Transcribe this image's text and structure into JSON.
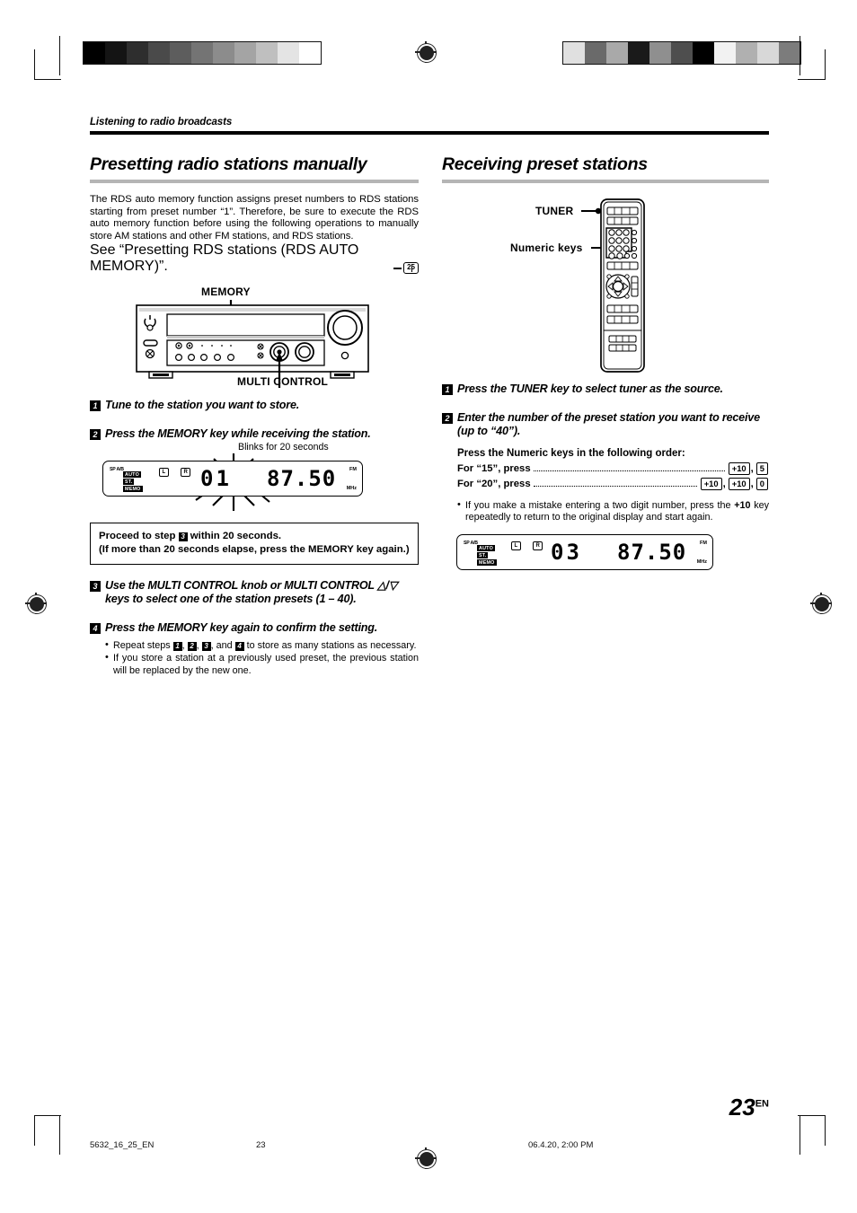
{
  "page": {
    "running_head": "Listening to radio broadcasts",
    "folio_number": "23",
    "folio_suffix": "EN"
  },
  "footer": {
    "filename": "5632_16_25_EN",
    "page": "23",
    "timestamp": "06.4.20, 2:00 PM"
  },
  "left_column": {
    "title": "Presetting radio stations manually",
    "intro": "The RDS auto memory function assigns preset numbers to RDS stations starting from preset number “1”. Therefore, be sure to execute the RDS auto memory function before using the following operations to manually store AM stations and other FM stations, and RDS stations.",
    "see_line": "See “Presetting RDS stations (RDS AUTO MEMORY)”.",
    "page_reference": "25",
    "device_callout_top": "MEMORY",
    "device_callout_bottom": "MULTI CONTROL",
    "steps": [
      {
        "num": "1",
        "text": "Tune to the station you want to store."
      },
      {
        "num": "2",
        "text": "Press the MEMORY key while receiving the station."
      },
      {
        "num": "3",
        "text": "Use the MULTI CONTROL knob or MULTI CONTROL △/▽ keys to select one of the station presets (1 – 40)."
      },
      {
        "num": "4",
        "text": "Press the MEMORY key  again to confirm the setting."
      }
    ],
    "blink_label": "Blinks for 20 seconds",
    "note_box": {
      "line1_before": "Proceed to step ",
      "line1_step": "3",
      "line1_after": " within 20 seconds.",
      "line2": "(If more than 20 seconds elapse, press the MEMORY key again.)"
    },
    "bullets": [
      {
        "before": "Repeat steps ",
        "steps": [
          "1",
          "2",
          "3",
          "4"
        ],
        "after": " to store as many stations as necessary."
      },
      {
        "before": "",
        "steps": [],
        "after": "If you store a station at a previously used preset, the previous station will be replaced by the new one."
      }
    ],
    "lcd": {
      "sp_indicator": "SP A/B",
      "tags": [
        "AUTO",
        "ST.",
        "MEMO"
      ],
      "left_channel": "L",
      "right_channel": "R",
      "preset_digits": "01",
      "frequency": "87.50",
      "band": "FM",
      "unit": "MHz"
    }
  },
  "right_column": {
    "title": "Receiving preset stations",
    "remote_callout_tuner": "TUNER",
    "remote_callout_numeric": "Numeric keys",
    "steps": [
      {
        "num": "1",
        "text": "Press the TUNER key to select tuner as the source."
      },
      {
        "num": "2",
        "text": "Enter the number of the preset station you want to receive (up to “40”)."
      }
    ],
    "numeric_instruction": "Press the Numeric keys in the following order:",
    "key_rows": [
      {
        "label": "For “15”, press",
        "keys": [
          "+10",
          "5"
        ]
      },
      {
        "label": "For “20”, press",
        "keys": [
          "+10",
          "+10",
          "0"
        ]
      }
    ],
    "bullet": {
      "before": "If you make a mistake entering a two digit number, press the ",
      "bold": "+10",
      "after": " key repeatedly to return to the original display and start again."
    },
    "lcd": {
      "sp_indicator": "SP A/B",
      "tags": [
        "AUTO",
        "ST.",
        "MEMO"
      ],
      "left_channel": "L",
      "right_channel": "R",
      "preset_digits": "03",
      "frequency": "87.50",
      "band": "FM",
      "unit": "MHz"
    }
  },
  "calibration": {
    "left_bar": [
      "#000000",
      "#141414",
      "#2e2e2e",
      "#4a4a4a",
      "#5d5d5d",
      "#747474",
      "#8c8c8c",
      "#a4a4a4",
      "#bfbfbf",
      "#e4e4e4",
      "#ffffff"
    ],
    "right_bar": [
      "#e0e0e0",
      "#6a6a6a",
      "#a9a9a9",
      "#1a1a1a",
      "#8f8f8f",
      "#4e4e4e",
      "#000000",
      "#f2f2f2",
      "#b0b0b0",
      "#d8d8d8",
      "#7c7c7c"
    ]
  }
}
